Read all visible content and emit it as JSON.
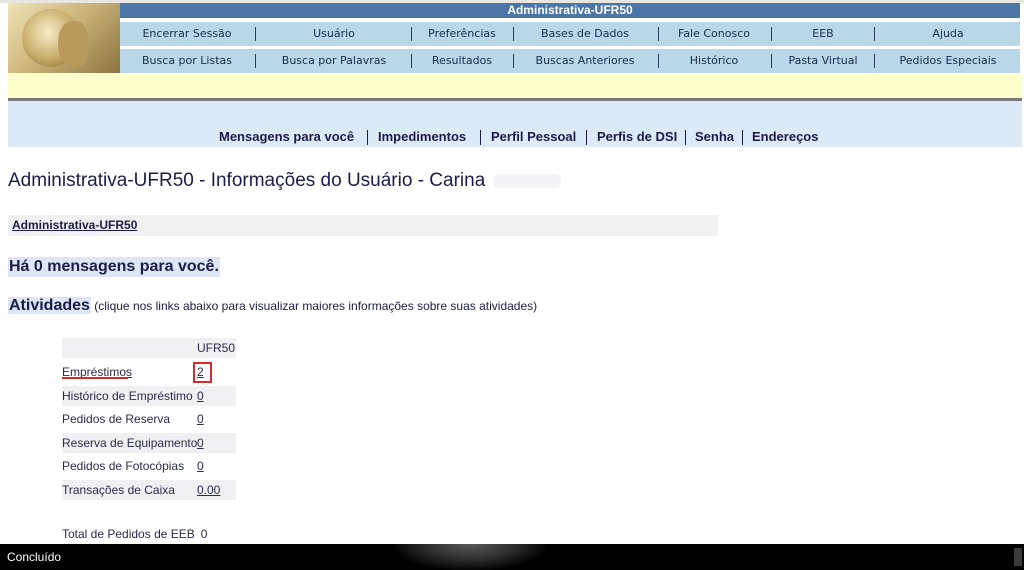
{
  "banner": {
    "title": "Administrativa-UFR50"
  },
  "nav_row1": [
    "Encerrar Sessão",
    "Usuário",
    "Preferências",
    "Bases de Dados",
    "Fale Conosco",
    "EEB",
    "Ajuda"
  ],
  "nav_row2": [
    "Busca por Listas",
    "Busca por Palavras",
    "Resultados",
    "Buscas Anteriores",
    "Histórico",
    "Pasta Virtual",
    "Pedidos Especiais"
  ],
  "secondary_nav": [
    "Mensagens para você",
    "Impedimentos",
    "Perfil Pessoal",
    "Perfis de DSI",
    "Senha",
    "Endereços"
  ],
  "page": {
    "title": "Administrativa-UFR50 - Informações do Usuário - Carina",
    "library_link": "Administrativa-UFR50",
    "messages": "Há 0 mensagens para você.",
    "activities_heading": "Atividades",
    "activities_desc": " (clique nos links abaixo para visualizar maiores informações sobre suas atividades)"
  },
  "activities_table": {
    "column": "UFR50",
    "rows": [
      {
        "label": "Empréstimos",
        "value": "2"
      },
      {
        "label": "Histórico de Empréstimo",
        "value": "0"
      },
      {
        "label": "Pedidos de Reserva",
        "value": "0"
      },
      {
        "label": "Reserva de Equipamento",
        "value": "0"
      },
      {
        "label": "Pedidos de Fotocópias",
        "value": "0"
      },
      {
        "label": "Transações de Caixa",
        "value": "0.00"
      }
    ],
    "total_label": "Total de Pedidos de EEB",
    "total_value": "0"
  },
  "status_bar": {
    "text": "Concluído"
  },
  "colors": {
    "banner": "#4c75a8",
    "nav_background": "#b8d8ea",
    "highlight": "#d82a2a",
    "text": "#1c1c48"
  }
}
